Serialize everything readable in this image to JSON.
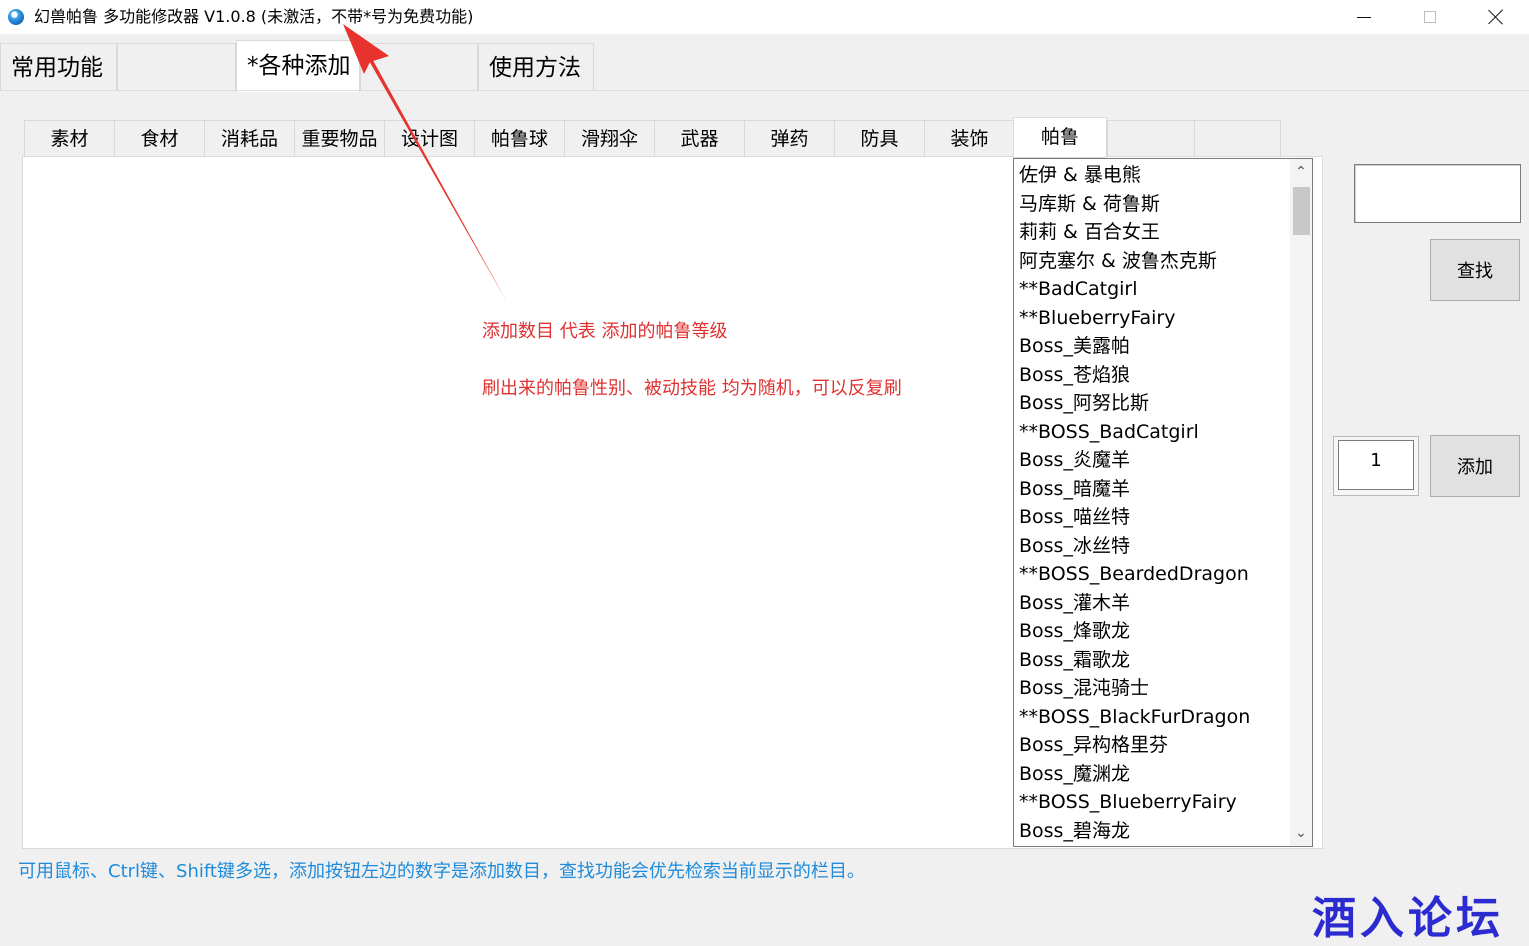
{
  "window": {
    "title": "幻兽帕鲁 多功能修改器  V1.0.8 (未激活，不带*号为免费功能)"
  },
  "main_tabs": [
    {
      "label": "常用功能",
      "active": false
    },
    {
      "label": "*各种添加",
      "active": true
    },
    {
      "label": "使用方法",
      "active": false
    }
  ],
  "sub_tabs": [
    {
      "label": "素材"
    },
    {
      "label": "食材"
    },
    {
      "label": "消耗品"
    },
    {
      "label": "重要物品"
    },
    {
      "label": "设计图"
    },
    {
      "label": "帕鲁球"
    },
    {
      "label": "滑翔伞"
    },
    {
      "label": "武器"
    },
    {
      "label": "弹药"
    },
    {
      "label": "防具"
    },
    {
      "label": "装饰"
    },
    {
      "label": "帕鲁",
      "active": true
    },
    {
      "label": ""
    },
    {
      "label": ""
    }
  ],
  "notes": {
    "line1": "添加数目 代表 添加的帕鲁等级",
    "line2": "刷出来的帕鲁性别、被动技能 均为随机，可以反复刷"
  },
  "pal_list": [
    "佐伊 & 暴电熊",
    "马库斯 & 荷鲁斯",
    "莉莉 & 百合女王",
    "阿克塞尔 & 波鲁杰克斯",
    "**BadCatgirl",
    "**BlueberryFairy",
    "Boss_美露帕",
    "Boss_苍焰狼",
    "Boss_阿努比斯",
    "**BOSS_BadCatgirl",
    "Boss_炎魔羊",
    "Boss_暗魔羊",
    "Boss_喵丝特",
    "Boss_冰丝特",
    "**BOSS_BeardedDragon",
    "Boss_灌木羊",
    "Boss_烽歌龙",
    "Boss_霜歌龙",
    "Boss_混沌骑士",
    "**BOSS_BlackFurDragon",
    "Boss_异构格里芬",
    "Boss_魔渊龙",
    "**BOSS_BlueberryFairy",
    "Boss_碧海龙"
  ],
  "search": {
    "value": ""
  },
  "buttons": {
    "find": "查找",
    "add": "添加"
  },
  "quantity": "1",
  "hint": "可用鼠标、Ctrl键、Shift键多选，添加按钮左边的数字是添加数目，查找功能会优先检索当前显示的栏目。",
  "watermark": "酒入论坛",
  "colors": {
    "note": "#e03131",
    "hint": "#1e8bdb",
    "arrow": "#e8322d",
    "watermark": "#2b2bd0"
  }
}
